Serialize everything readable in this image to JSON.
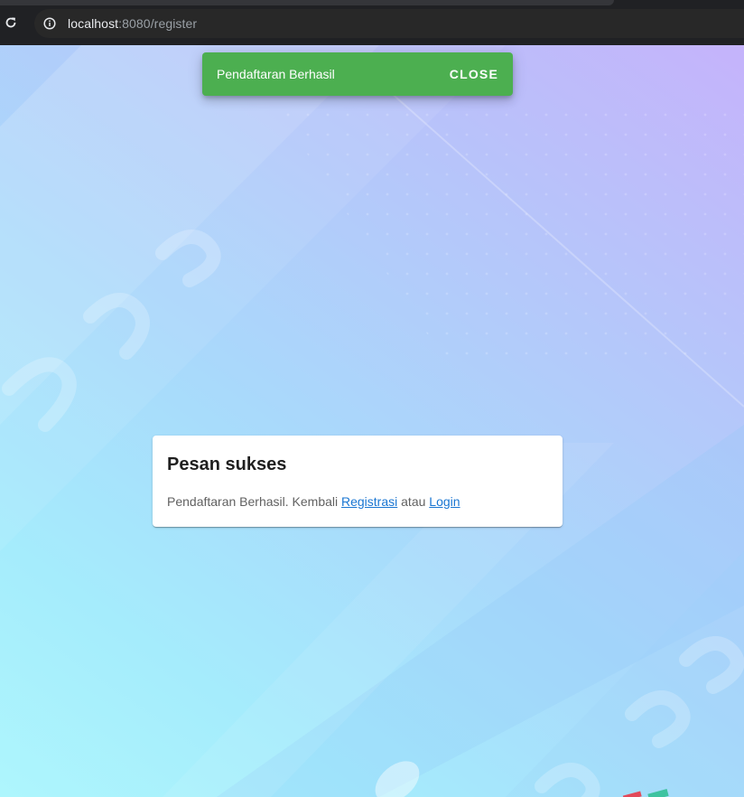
{
  "browser": {
    "url_host": "localhost",
    "url_rest": ":8080/register"
  },
  "snackbar": {
    "message": "Pendaftaran Berhasil",
    "close_label": "CLOSE",
    "color": "#4caf50"
  },
  "card": {
    "title": "Pesan sukses",
    "message": "Pendaftaran Berhasil. Kembali",
    "register_link": "Registrasi",
    "connector": "atau",
    "login_link": "Login"
  },
  "colors": {
    "link": "#1976d2",
    "browser_bar": "#202124"
  }
}
